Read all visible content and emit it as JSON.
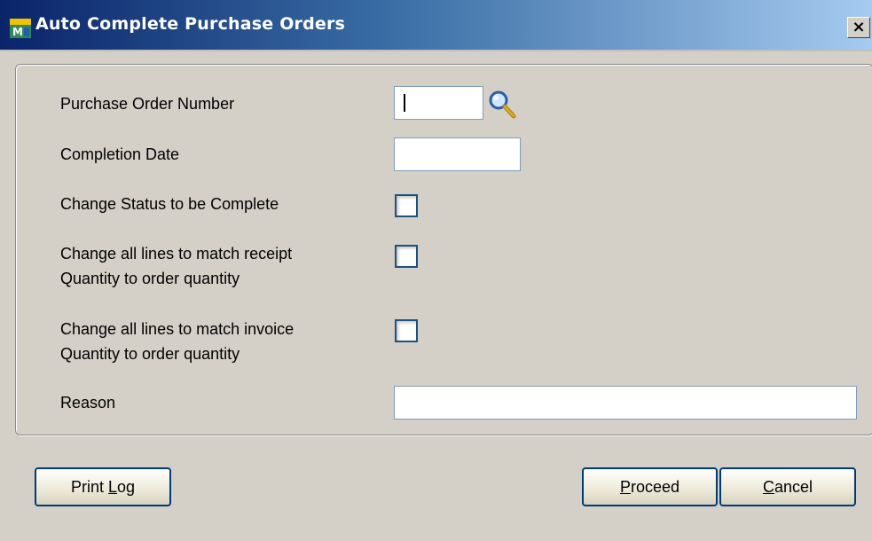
{
  "window": {
    "title": "Auto Complete Purchase Orders",
    "close_glyph": "×",
    "icon": "app-icon"
  },
  "form": {
    "po_number": {
      "label": "Purchase Order Number",
      "value": "",
      "lookup_icon": "magnifier-icon"
    },
    "completion_date": {
      "label": "Completion Date",
      "value": ""
    },
    "change_status": {
      "label": "Change Status to be Complete",
      "checked": false
    },
    "match_receipt": {
      "label_line1": "Change all lines to match receipt",
      "label_line2": "Quantity to order quantity",
      "checked": false
    },
    "match_invoice": {
      "label_line1": "Change all lines to match invoice",
      "label_line2": "Quantity to order quantity",
      "checked": false
    },
    "reason": {
      "label": "Reason",
      "value": ""
    }
  },
  "buttons": {
    "print_log": {
      "prefix": "Print ",
      "mnemonic": "L",
      "suffix": "og"
    },
    "proceed": {
      "prefix": "",
      "mnemonic": "P",
      "suffix": "roceed"
    },
    "cancel": {
      "prefix": "",
      "mnemonic": "C",
      "suffix": "ancel"
    }
  },
  "colors": {
    "titlebar_start": "#0a246a",
    "titlebar_end": "#a6caf0",
    "dialog_bg": "#d4d0c8",
    "button_border": "#003c74"
  }
}
